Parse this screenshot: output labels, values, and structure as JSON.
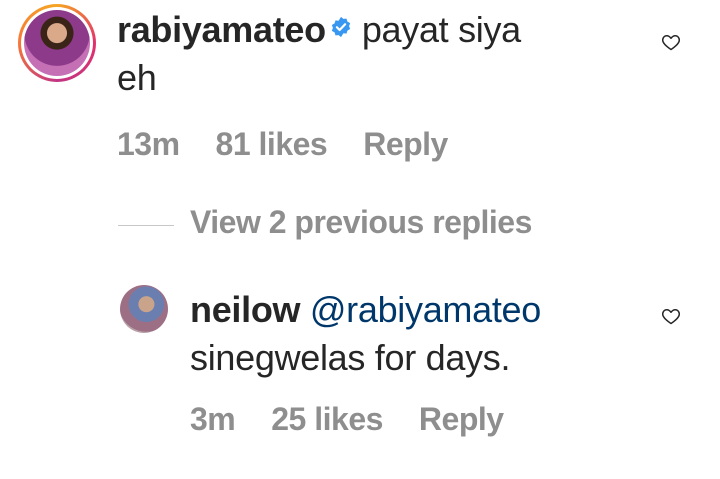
{
  "comment": {
    "username": "rabiyamateo",
    "text_line1": "payat siya",
    "text_line2": "eh",
    "time": "13m",
    "likes": "81 likes",
    "reply_label": "Reply"
  },
  "view_replies_label": "View 2 previous replies",
  "reply": {
    "username": "neilow",
    "mention": "@rabiyamateo",
    "text": "sinegwelas for days.",
    "time": "3m",
    "likes": "25 likes",
    "reply_label": "Reply"
  },
  "icons": {
    "verified": "verified-badge-icon",
    "like": "heart-outline-icon"
  },
  "colors": {
    "text": "#262626",
    "muted": "#8e8e8e",
    "mention": "#00376b",
    "verified": "#3897f0"
  }
}
